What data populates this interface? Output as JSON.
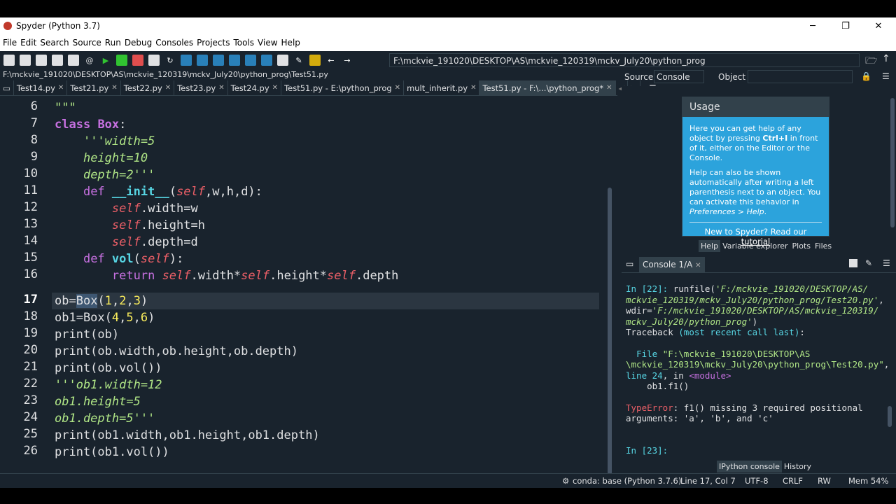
{
  "window": {
    "title": "Spyder (Python 3.7)",
    "minimize": "─",
    "maximize": "❐",
    "close": "✕"
  },
  "menu": [
    "File",
    "Edit",
    "Search",
    "Source",
    "Run",
    "Debug",
    "Consoles",
    "Projects",
    "Tools",
    "View",
    "Help"
  ],
  "toolbar": {
    "working_dir": "F:\\mckvie_191020\\DESKTOP\\AS\\mckvie_120319\\mckv_July20\\python_prog"
  },
  "editor": {
    "file_path": "F:\\mckvie_191020\\DESKTOP\\AS\\mckvie_120319\\mckv_July20\\python_prog\\Test51.py",
    "tabs": [
      "Test14.py",
      "Test21.py",
      "Test22.py",
      "Test23.py",
      "Test24.py",
      "Test51.py - E:\\python_prog",
      "mult_inherit.py",
      "Test51.py - F:\\...\\python_prog*"
    ],
    "active_tab": 7,
    "line_numbers": [
      "6",
      "7",
      "8",
      "9",
      "10",
      "11",
      "12",
      "13",
      "14",
      "15",
      "16",
      "17",
      "18",
      "19",
      "20",
      "21",
      "22",
      "23",
      "24",
      "25",
      "26"
    ],
    "current_line": "17"
  },
  "help": {
    "source_label": "Source",
    "source_value": "Console",
    "object_label": "Object",
    "usage_title": "Usage",
    "usage_p1_a": "Here you can get help of any object by pressing ",
    "usage_p1_key": "Ctrl+I",
    "usage_p1_b": " in front of it, either on the Editor or the Console.",
    "usage_p2_a": "Help can also be shown automatically after writing a left parenthesis next to an object. You can activate this behavior in ",
    "usage_p2_pref": "Preferences > Help",
    "usage_new": "New to Spyder? Read our ",
    "usage_link": "tutorial",
    "tabs": [
      "Help",
      "Variable explorer",
      "Plots",
      "Files"
    ]
  },
  "console": {
    "tab": "Console 1/A",
    "tabs": [
      "IPython console",
      "History"
    ]
  },
  "status": {
    "env": "conda: base (Python 3.7.6)",
    "position": "Line 17, Col 7",
    "encoding": "UTF-8",
    "eol": "CRLF",
    "mode": "RW",
    "mem": "Mem 54%"
  }
}
